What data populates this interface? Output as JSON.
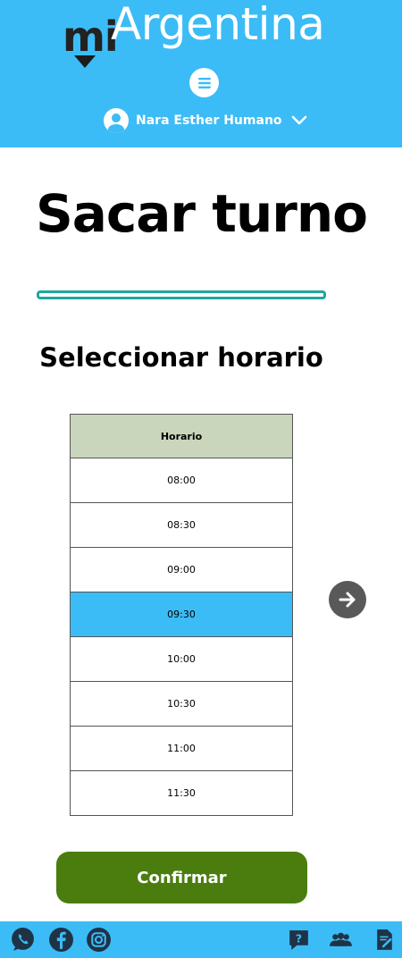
{
  "header": {
    "logo_mi": "mi",
    "logo_argentina": "Argentina",
    "menu_icon": "hamburger-menu-icon",
    "user_name": "Nara Esther Humano",
    "user_icon": "user-avatar-icon",
    "chevron_icon": "chevron-down-icon"
  },
  "main": {
    "title": "Sacar turno",
    "subtitle": "Seleccionar horario",
    "table": {
      "header": "Horario",
      "rows": [
        "08:00",
        "08:30",
        "09:00",
        "09:30",
        "10:00",
        "10:30",
        "11:00",
        "11:30"
      ],
      "selected": "09:30"
    },
    "next_icon": "arrow-right-icon",
    "confirm_label": "Confirmar"
  },
  "footer": {
    "icons": [
      "whatsapp-icon",
      "facebook-icon",
      "instagram-icon",
      "help-chat-icon",
      "people-icon",
      "document-edit-icon"
    ]
  },
  "colors": {
    "header_bg": "#3bbcf6",
    "table_header_bg": "#c9d6bb",
    "selected_row_bg": "#3bbcf6",
    "confirm_bg": "#4b7d0e",
    "next_button_bg": "#595959",
    "progress_border": "#1fa6a0"
  }
}
